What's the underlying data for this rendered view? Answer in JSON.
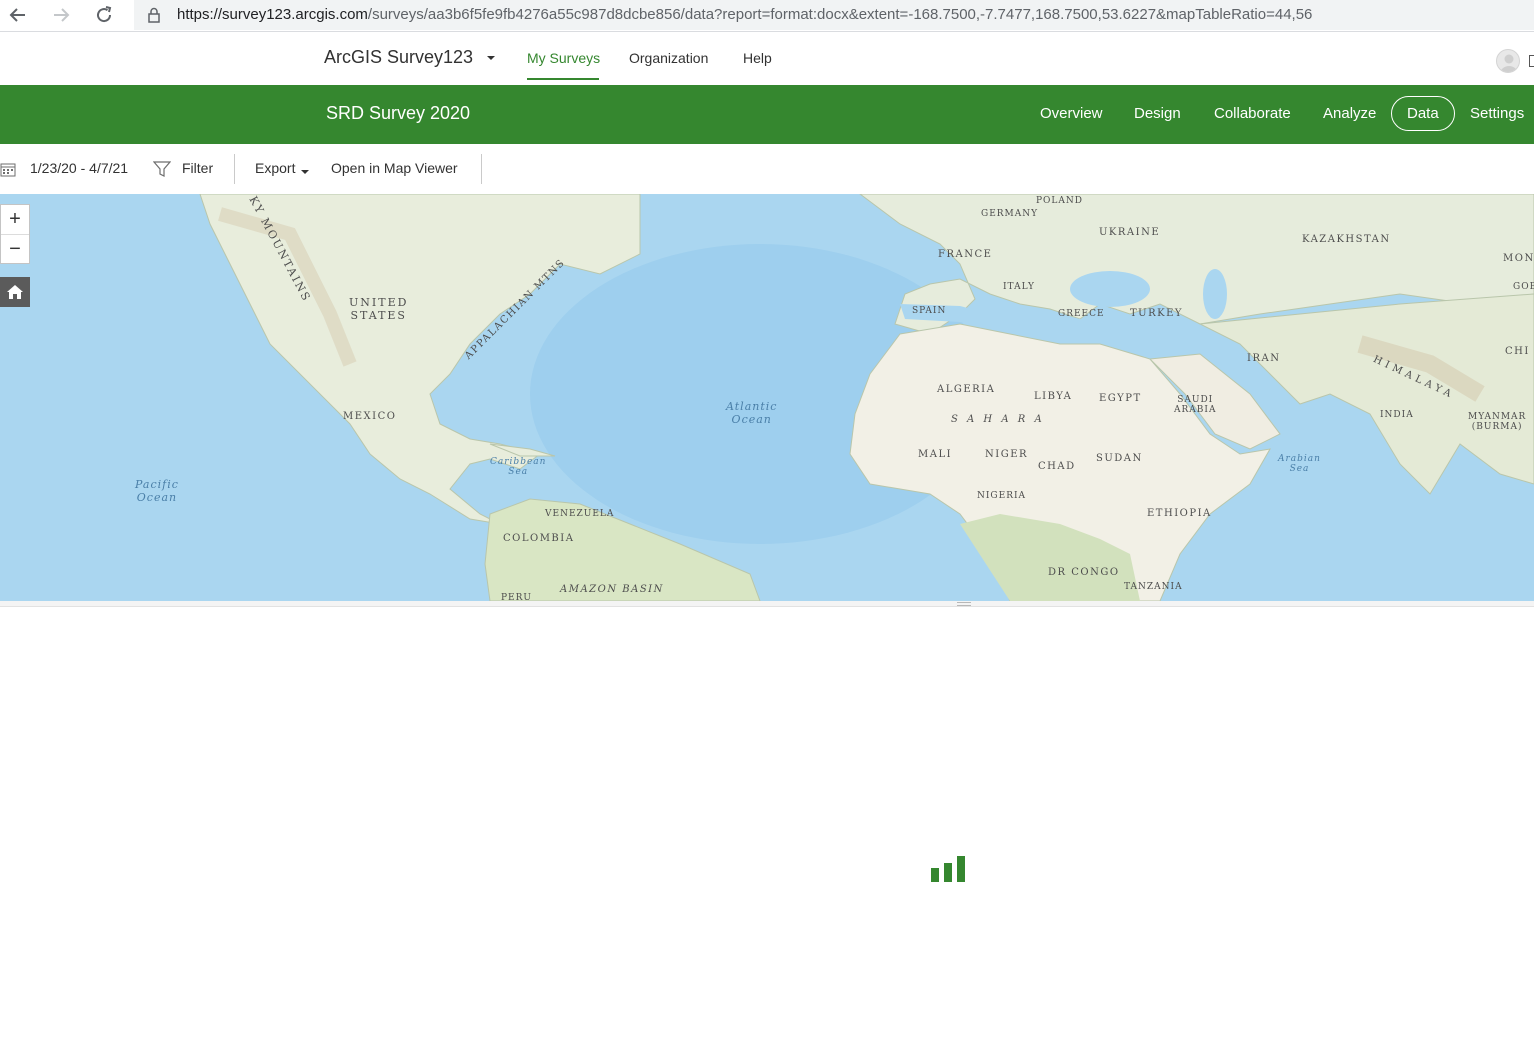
{
  "browser": {
    "url_host": "https://survey123.arcgis.com",
    "url_path": "/surveys/aa3b6f5fe9fb4276a55c987d8dcbe856/data?report=format:docx&extent=-168.7500,-7.7477,168.7500,53.6227&mapTableRatio=44,56"
  },
  "header": {
    "app_title": "ArcGIS Survey123",
    "nav": {
      "my_surveys": "My Surveys",
      "organization": "Organization",
      "help": "Help"
    },
    "accent_color": "#35872f"
  },
  "survey": {
    "title": "SRD Survey 2020",
    "tabs": {
      "overview": "Overview",
      "design": "Design",
      "collaborate": "Collaborate",
      "analyze": "Analyze",
      "data": "Data",
      "settings": "Settings"
    },
    "active_tab": "Data"
  },
  "toolbar": {
    "date_range": "1/23/20 - 4/7/21",
    "filter": "Filter",
    "export": "Export",
    "open_map_viewer": "Open in Map Viewer"
  },
  "map": {
    "labels": {
      "rocky": "KY MOUNTAINS",
      "united_states": "UNITED\nSTATES",
      "appalachian": "APPALACHIAN MTNS",
      "mexico": "MEXICO",
      "pacific": "Pacific\nOcean",
      "caribbean": "Caribbean\nSea",
      "atlantic": "Atlantic\nOcean",
      "venezuela": "VENEZUELA",
      "colombia": "COLOMBIA",
      "amazon": "AMAZON BASIN",
      "peru": "PERU",
      "poland": "POLAND",
      "germany": "GERMANY",
      "ukraine": "UKRAINE",
      "kazakhstan": "KAZAKHSTAN",
      "mon": "MON",
      "gob": "GOB",
      "france": "FRANCE",
      "italy": "ITALY",
      "spain": "SPAIN",
      "greece": "GREECE",
      "turkey": "TURKEY",
      "chi": "CHI",
      "iran": "IRAN",
      "himalaya": "HIMALAYA",
      "algeria": "ALGERIA",
      "libya": "LIBYA",
      "egypt": "EGYPT",
      "saudi": "SAUDI\nARABIA",
      "india": "INDIA",
      "myanmar": "MYANMAR\n(BURMA)",
      "sahara": "S A H A R A",
      "mali": "MALI",
      "niger": "NIGER",
      "chad": "CHAD",
      "sudan": "SUDAN",
      "arabian": "Arabian\nSea",
      "nigeria": "NIGERIA",
      "ethiopia": "ETHIOPIA",
      "drcongo": "DR CONGO",
      "tanzania": "TANZANIA"
    },
    "zoom_in": "+",
    "zoom_out": "−"
  }
}
